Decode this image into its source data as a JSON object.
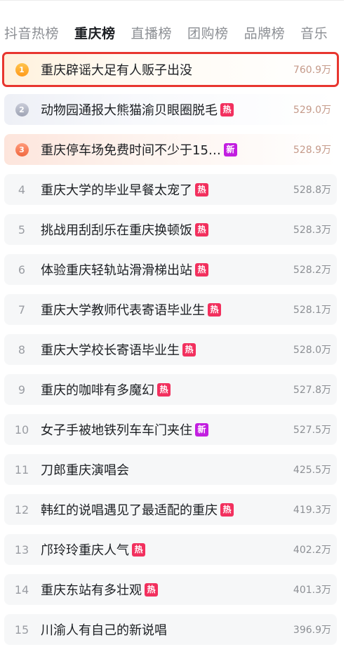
{
  "tabs": [
    {
      "label": "抖音热榜",
      "active": false
    },
    {
      "label": "重庆榜",
      "active": true
    },
    {
      "label": "直播榜",
      "active": false
    },
    {
      "label": "团购榜",
      "active": false
    },
    {
      "label": "品牌榜",
      "active": false
    },
    {
      "label": "音乐",
      "active": false
    }
  ],
  "colors": {
    "hot_badge": "#f2305e",
    "new_badge": "#c21ee0",
    "highlight_outline": "#e8362f"
  },
  "items": [
    {
      "rank": "1",
      "title": "重庆辟谣大足有人贩子出没",
      "badge": "",
      "heat": "760.9万",
      "medal": "gold"
    },
    {
      "rank": "2",
      "title": "动物园通报大熊猫渝贝眼圈脱毛",
      "badge": "热",
      "heat": "529.0万",
      "medal": "silver"
    },
    {
      "rank": "3",
      "title": "重庆停车场免费时间不少于15…",
      "badge": "新",
      "heat": "528.9万",
      "medal": "bronze"
    },
    {
      "rank": "4",
      "title": "重庆大学的毕业早餐太宠了",
      "badge": "热",
      "heat": "528.8万"
    },
    {
      "rank": "5",
      "title": "挑战用刮刮乐在重庆换顿饭",
      "badge": "热",
      "heat": "528.3万"
    },
    {
      "rank": "6",
      "title": "体验重庆轻轨站滑滑梯出站",
      "badge": "热",
      "heat": "528.2万"
    },
    {
      "rank": "7",
      "title": "重庆大学教师代表寄语毕业生",
      "badge": "热",
      "heat": "528.1万"
    },
    {
      "rank": "8",
      "title": "重庆大学校长寄语毕业生",
      "badge": "热",
      "heat": "528.0万"
    },
    {
      "rank": "9",
      "title": "重庆的咖啡有多魔幻",
      "badge": "热",
      "heat": "527.8万"
    },
    {
      "rank": "10",
      "title": "女子手被地铁列车车门夹住",
      "badge": "新",
      "heat": "527.5万"
    },
    {
      "rank": "11",
      "title": "刀郎重庆演唱会",
      "badge": "",
      "heat": "425.5万"
    },
    {
      "rank": "12",
      "title": "韩红的说唱遇见了最适配的重庆",
      "badge": "热",
      "heat": "419.3万"
    },
    {
      "rank": "13",
      "title": "邝玲玲重庆人气",
      "badge": "热",
      "heat": "402.2万"
    },
    {
      "rank": "14",
      "title": "重庆东站有多壮观",
      "badge": "热",
      "heat": "401.3万"
    },
    {
      "rank": "15",
      "title": "川渝人有自己的新说唱",
      "badge": "",
      "heat": "396.9万"
    }
  ]
}
